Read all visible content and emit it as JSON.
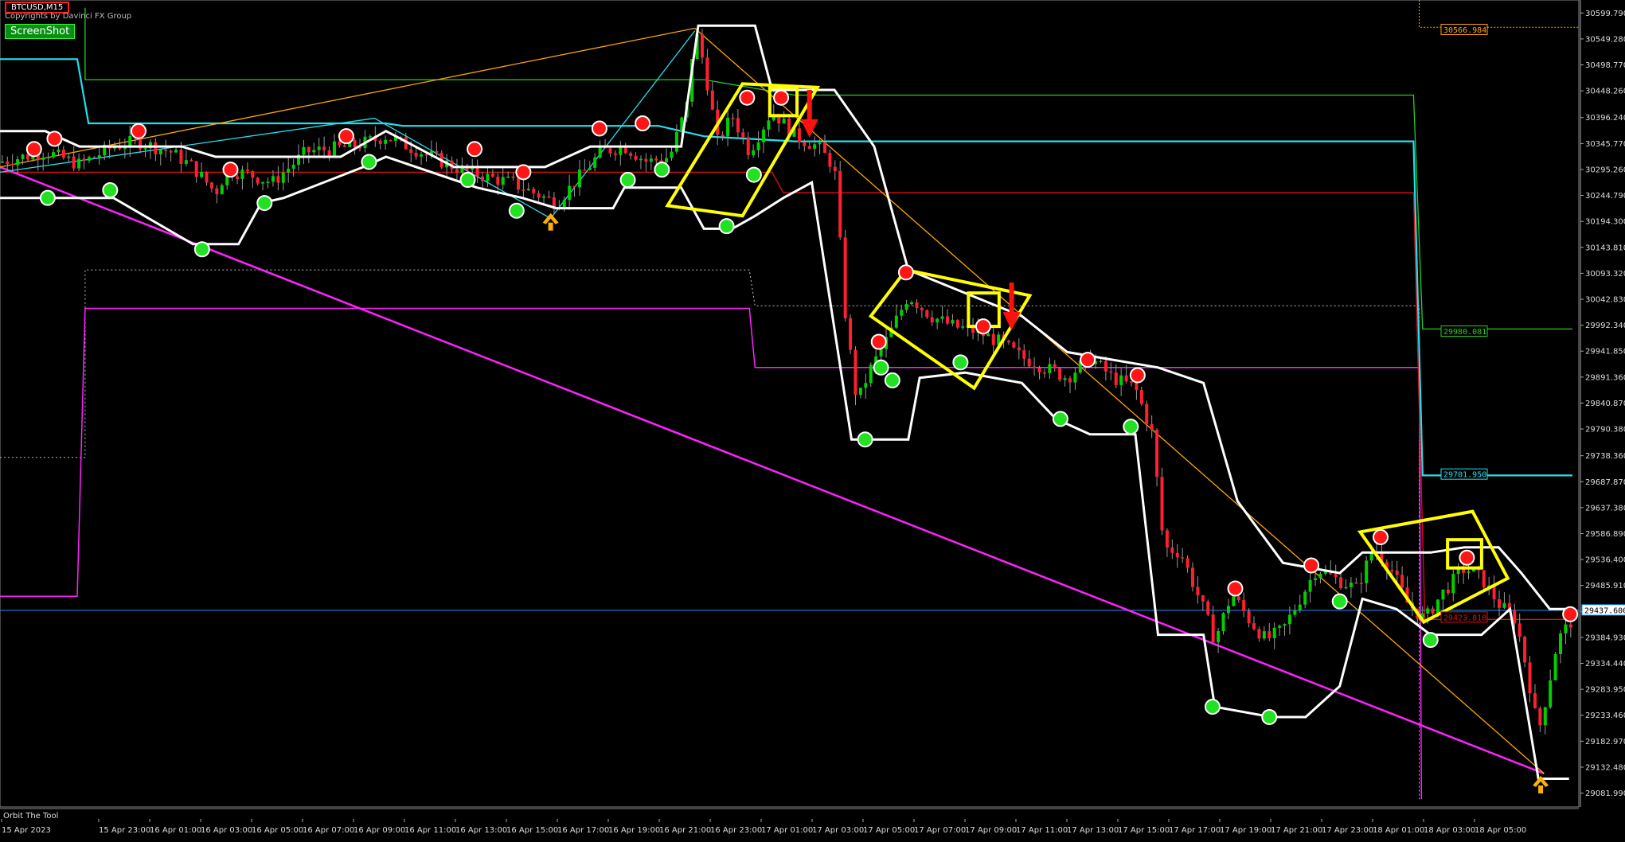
{
  "header": {
    "symbol": "BTCUSD,M15",
    "copyright": "Copyrights by Davinci FX Group",
    "screenshot_label": "ScreenShot"
  },
  "footer": {
    "indicator_name": "Orbit The Tool"
  },
  "colors": {
    "up": "#00d000",
    "down": "#ff1f30",
    "band": "#ffffff",
    "cyan": "#22e0ee",
    "green": "#22d022",
    "red": "#e01010",
    "magenta": "#ff22ff",
    "orange": "#ffa500",
    "yellow": "#ffff00",
    "grid_bg": "#000000"
  },
  "chart_data": {
    "type": "candlestick",
    "symbol": "BTCUSD",
    "timeframe": "M15",
    "ylim": [
      29055,
      30625
    ],
    "y_ticks": [
      30599.79,
      30549.28,
      30498.77,
      30448.26,
      30396.24,
      30345.77,
      30295.26,
      30244.79,
      30194.3,
      30143.81,
      30093.32,
      30042.83,
      29992.34,
      29941.85,
      29891.36,
      29840.87,
      29790.38,
      29738.36,
      29687.87,
      29637.38,
      29586.89,
      29536.4,
      29485.91,
      29435.42,
      29384.93,
      29334.44,
      29283.95,
      29233.46,
      29182.97,
      29132.48,
      29081.99
    ],
    "x_labels": [
      "15 Apr 2023",
      "15 Apr 23:00",
      "16 Apr 01:00",
      "16 Apr 03:00",
      "16 Apr 05:00",
      "16 Apr 07:00",
      "16 Apr 09:00",
      "16 Apr 11:00",
      "16 Apr 13:00",
      "16 Apr 15:00",
      "16 Apr 17:00",
      "16 Apr 19:00",
      "16 Apr 21:00",
      "16 Apr 23:00",
      "17 Apr 01:00",
      "17 Apr 03:00",
      "17 Apr 05:00",
      "17 Apr 07:00",
      "17 Apr 09:00",
      "17 Apr 11:00",
      "17 Apr 13:00",
      "17 Apr 15:00",
      "17 Apr 17:00",
      "17 Apr 19:00",
      "17 Apr 21:00",
      "17 Apr 23:00",
      "18 Apr 01:00",
      "18 Apr 03:00",
      "18 Apr 05:00"
    ],
    "price_path": [
      [
        0,
        30310
      ],
      [
        40,
        30330
      ],
      [
        70,
        30305
      ],
      [
        100,
        30340
      ],
      [
        120,
        30350
      ],
      [
        150,
        30330
      ],
      [
        170,
        30300
      ],
      [
        190,
        30250
      ],
      [
        200,
        30295
      ],
      [
        220,
        30285
      ],
      [
        240,
        30270
      ],
      [
        270,
        30330
      ],
      [
        310,
        30340
      ],
      [
        340,
        30360
      ],
      [
        360,
        30340
      ],
      [
        380,
        30320
      ],
      [
        400,
        30300
      ],
      [
        430,
        30280
      ],
      [
        450,
        30270
      ],
      [
        470,
        30250
      ],
      [
        490,
        30230
      ],
      [
        510,
        30280
      ],
      [
        530,
        30330
      ],
      [
        550,
        30340
      ],
      [
        570,
        30310
      ],
      [
        590,
        30320
      ],
      [
        605,
        30420
      ],
      [
        612,
        30570
      ],
      [
        620,
        30500
      ],
      [
        632,
        30350
      ],
      [
        645,
        30400
      ],
      [
        660,
        30330
      ],
      [
        680,
        30410
      ],
      [
        700,
        30360
      ],
      [
        720,
        30340
      ],
      [
        735,
        30300
      ],
      [
        745,
        30000
      ],
      [
        755,
        29840
      ],
      [
        765,
        29900
      ],
      [
        780,
        29960
      ],
      [
        800,
        30050
      ],
      [
        820,
        30010
      ],
      [
        840,
        29990
      ],
      [
        860,
        29980
      ],
      [
        880,
        29960
      ],
      [
        900,
        29930
      ],
      [
        920,
        29910
      ],
      [
        940,
        29890
      ],
      [
        960,
        29930
      ],
      [
        980,
        29890
      ],
      [
        1000,
        29870
      ],
      [
        1015,
        29780
      ],
      [
        1025,
        29560
      ],
      [
        1040,
        29550
      ],
      [
        1060,
        29440
      ],
      [
        1070,
        29380
      ],
      [
        1085,
        29470
      ],
      [
        1100,
        29420
      ],
      [
        1115,
        29380
      ],
      [
        1130,
        29400
      ],
      [
        1145,
        29460
      ],
      [
        1160,
        29520
      ],
      [
        1175,
        29500
      ],
      [
        1195,
        29480
      ],
      [
        1210,
        29560
      ],
      [
        1225,
        29520
      ],
      [
        1240,
        29450
      ],
      [
        1255,
        29420
      ],
      [
        1270,
        29470
      ],
      [
        1290,
        29520
      ],
      [
        1305,
        29500
      ],
      [
        1320,
        29450
      ],
      [
        1335,
        29420
      ],
      [
        1345,
        29320
      ],
      [
        1355,
        29200
      ],
      [
        1362,
        29270
      ],
      [
        1372,
        29380
      ],
      [
        1385,
        29420
      ]
    ],
    "upper_band": [
      [
        0,
        30370
      ],
      [
        40,
        30370
      ],
      [
        70,
        30340
      ],
      [
        160,
        30340
      ],
      [
        190,
        30320
      ],
      [
        300,
        30320
      ],
      [
        340,
        30370
      ],
      [
        400,
        30300
      ],
      [
        480,
        30300
      ],
      [
        520,
        30340
      ],
      [
        600,
        30340
      ],
      [
        615,
        30575
      ],
      [
        665,
        30575
      ],
      [
        680,
        30450
      ],
      [
        735,
        30450
      ],
      [
        770,
        30340
      ],
      [
        800,
        30100
      ],
      [
        900,
        30010
      ],
      [
        940,
        29940
      ],
      [
        1020,
        29910
      ],
      [
        1060,
        29880
      ],
      [
        1090,
        29650
      ],
      [
        1130,
        29530
      ],
      [
        1180,
        29510
      ],
      [
        1200,
        29550
      ],
      [
        1260,
        29550
      ],
      [
        1290,
        29560
      ],
      [
        1320,
        29560
      ],
      [
        1340,
        29510
      ],
      [
        1365,
        29440
      ],
      [
        1385,
        29440
      ]
    ],
    "lower_band": [
      [
        0,
        30240
      ],
      [
        40,
        30240
      ],
      [
        100,
        30240
      ],
      [
        170,
        30150
      ],
      [
        210,
        30150
      ],
      [
        230,
        30230
      ],
      [
        250,
        30240
      ],
      [
        320,
        30300
      ],
      [
        340,
        30320
      ],
      [
        420,
        30260
      ],
      [
        460,
        30240
      ],
      [
        490,
        30220
      ],
      [
        540,
        30220
      ],
      [
        550,
        30260
      ],
      [
        600,
        30260
      ],
      [
        620,
        30180
      ],
      [
        645,
        30180
      ],
      [
        665,
        30205
      ],
      [
        690,
        30240
      ],
      [
        715,
        30270
      ],
      [
        750,
        29770
      ],
      [
        800,
        29770
      ],
      [
        810,
        29890
      ],
      [
        850,
        29900
      ],
      [
        900,
        29880
      ],
      [
        930,
        29810
      ],
      [
        960,
        29780
      ],
      [
        1000,
        29780
      ],
      [
        1020,
        29390
      ],
      [
        1060,
        29390
      ],
      [
        1070,
        29250
      ],
      [
        1120,
        29230
      ],
      [
        1150,
        29230
      ],
      [
        1180,
        29290
      ],
      [
        1200,
        29460
      ],
      [
        1230,
        29440
      ],
      [
        1260,
        29390
      ],
      [
        1305,
        29390
      ],
      [
        1330,
        29440
      ],
      [
        1355,
        29110
      ],
      [
        1382,
        29110
      ]
    ],
    "levels": [
      {
        "name": "upper-level",
        "color": "#ffa500",
        "style": "dotted",
        "value": 30566.984,
        "label": "30566.984"
      },
      {
        "name": "green-level",
        "color": "#22d022",
        "style": "solid",
        "value": 29980.081,
        "label": "29980.081"
      },
      {
        "name": "cyan-level",
        "color": "#22e0ee",
        "style": "solid",
        "value": 29701.95,
        "label": "29701.950"
      },
      {
        "name": "red-level",
        "color": "#e01010",
        "style": "solid",
        "value": 29423.818,
        "label": "29423.818"
      },
      {
        "name": "current-price",
        "color": "#22aaff",
        "style": "solid",
        "value": 29437.6,
        "label": "29437.600"
      }
    ],
    "step_lines": {
      "cyan": [
        [
          0,
          30510
        ],
        [
          68,
          30510
        ],
        [
          78,
          30385
        ],
        [
          300,
          30385
        ],
        [
          330,
          30385
        ],
        [
          340,
          30385
        ],
        [
          355,
          30380
        ],
        [
          580,
          30380
        ],
        [
          620,
          30360
        ],
        [
          700,
          30350
        ],
        [
          1245,
          30350
        ],
        [
          1253,
          29700
        ],
        [
          1385,
          29700
        ]
      ],
      "green": [
        [
          75,
          30610
        ],
        [
          75,
          30470
        ],
        [
          620,
          30470
        ],
        [
          700,
          30440
        ],
        [
          1245,
          30440
        ],
        [
          1253,
          29985
        ],
        [
          1385,
          29985
        ]
      ],
      "red": [
        [
          0,
          30290
        ],
        [
          500,
          30290
        ],
        [
          680,
          30290
        ],
        [
          690,
          30250
        ],
        [
          1245,
          30250
        ],
        [
          1255,
          29420
        ],
        [
          1385,
          29420
        ]
      ],
      "magenta": [
        [
          0,
          29465
        ],
        [
          68,
          29465
        ],
        [
          75,
          30025
        ],
        [
          660,
          30025
        ],
        [
          665,
          29910
        ],
        [
          1250,
          29910
        ],
        [
          1252,
          29070
        ]
      ],
      "dotted": [
        [
          0,
          29735
        ],
        [
          75,
          29735
        ],
        [
          75,
          30100
        ],
        [
          660,
          30100
        ],
        [
          665,
          30030
        ],
        [
          1250,
          30030
        ],
        [
          1250,
          29070
        ]
      ]
    },
    "trend_lines": [
      {
        "color": "#ff22ff",
        "from": [
          0,
          30300
        ],
        "to": [
          1360,
          29120
        ]
      },
      {
        "color": "#ffa500",
        "from": [
          0,
          30300
        ],
        "to": [
          612,
          30570
        ]
      },
      {
        "color": "#ffa500",
        "from": [
          612,
          30570
        ],
        "to": [
          1360,
          29120
        ]
      },
      {
        "color": "#22e0ee",
        "from": [
          0,
          30290
        ],
        "to": [
          330,
          30395
        ]
      },
      {
        "color": "#22e0ee",
        "from": [
          330,
          30395
        ],
        "to": [
          485,
          30200
        ]
      },
      {
        "color": "#22e0ee",
        "from": [
          485,
          30200
        ],
        "to": [
          612,
          30565
        ]
      }
    ],
    "sell_signals": [
      [
        30,
        30335
      ],
      [
        48,
        30355
      ],
      [
        122,
        30370
      ],
      [
        203,
        30295
      ],
      [
        305,
        30360
      ],
      [
        418,
        30335
      ],
      [
        461,
        30290
      ],
      [
        528,
        30375
      ],
      [
        566,
        30385
      ],
      [
        658,
        30435
      ],
      [
        688,
        30435
      ],
      [
        798,
        30095
      ],
      [
        774,
        29960
      ],
      [
        866,
        29990
      ],
      [
        958,
        29925
      ],
      [
        1002,
        29895
      ],
      [
        1088,
        29480
      ],
      [
        1155,
        29525
      ],
      [
        1216,
        29580
      ],
      [
        1292,
        29540
      ],
      [
        1383,
        29430
      ]
    ],
    "buy_signals": [
      [
        42,
        30240
      ],
      [
        97,
        30255
      ],
      [
        178,
        30140
      ],
      [
        233,
        30230
      ],
      [
        325,
        30310
      ],
      [
        412,
        30275
      ],
      [
        455,
        30215
      ],
      [
        553,
        30275
      ],
      [
        583,
        30295
      ],
      [
        640,
        30185
      ],
      [
        664,
        30285
      ],
      [
        776,
        29910
      ],
      [
        786,
        29885
      ],
      [
        846,
        29920
      ],
      [
        762,
        29770
      ],
      [
        934,
        29810
      ],
      [
        996,
        29795
      ],
      [
        1068,
        29250
      ],
      [
        1118,
        29230
      ],
      [
        1180,
        29455
      ],
      [
        1260,
        29380
      ]
    ],
    "arrows": [
      {
        "type": "up",
        "color": "#ffb000",
        "pt": [
          485,
          30195
        ]
      },
      {
        "type": "up",
        "color": "#ffb000",
        "pt": [
          1357,
          29100
        ]
      },
      {
        "type": "down",
        "color": "#ff1010",
        "pt": [
          713,
          30365
        ]
      },
      {
        "type": "down",
        "color": "#ff1010",
        "pt": [
          891,
          29990
        ]
      }
    ],
    "shapes": [
      {
        "type": "poly",
        "pts": [
          [
            588,
            30225
          ],
          [
            654,
            30205
          ],
          [
            720,
            30455
          ],
          [
            654,
            30462
          ]
        ]
      },
      {
        "type": "poly",
        "pts": [
          [
            767,
            30010
          ],
          [
            798,
            30100
          ],
          [
            907,
            30050
          ],
          [
            858,
            29870
          ]
        ]
      },
      {
        "type": "poly",
        "pts": [
          [
            1198,
            29590
          ],
          [
            1297,
            29630
          ],
          [
            1328,
            29500
          ],
          [
            1254,
            29415
          ]
        ]
      },
      {
        "type": "rect",
        "pts": [
          [
            678,
            30455
          ],
          [
            702,
            30400
          ]
        ]
      },
      {
        "type": "rect",
        "pts": [
          [
            853,
            30055
          ],
          [
            880,
            29990
          ]
        ]
      },
      {
        "type": "rect",
        "pts": [
          [
            1275,
            29575
          ],
          [
            1305,
            29520
          ]
        ]
      }
    ]
  }
}
